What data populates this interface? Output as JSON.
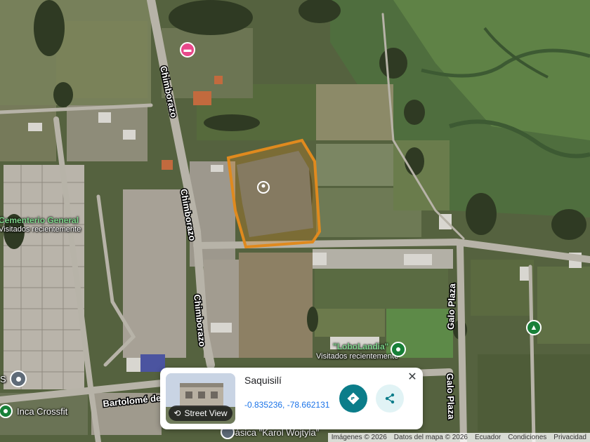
{
  "map": {
    "roads": [
      {
        "label": "Chimborazo",
        "id": "road-chimborazo-north"
      },
      {
        "label": "Chimborazo",
        "id": "road-chimborazo-middle"
      },
      {
        "label": "Chimborazo",
        "id": "road-chimborazo-south"
      },
      {
        "label": "Galo Plaza",
        "id": "road-galo-plaza-north"
      },
      {
        "label": "Galo Plaza",
        "id": "road-galo-plaza-south"
      },
      {
        "label": "Bartolomé de",
        "id": "road-bartolome"
      }
    ],
    "places": {
      "cementerio": {
        "name": "Cementerio General",
        "sub": "Visitados recientemente"
      },
      "lobolandia": {
        "name": "\"LoboLandia\"",
        "sub": "Visitados recientemente"
      },
      "inca": {
        "name": "Inca Crossfit"
      },
      "karol": {
        "name": "Básica \"Karol Wojtyla\""
      },
      "edge_s": {
        "name": "S"
      }
    },
    "icons": {
      "hotel": "bed-icon",
      "selected": "location-pin-icon",
      "park": "tree-icon"
    },
    "colors": {
      "selection_outline": "#e08a1e",
      "place_green": "#188038",
      "hotel_pink": "#e8488a",
      "action_teal": "#0b7d8a"
    }
  },
  "card": {
    "title": "Saquisilí",
    "coords": "-0.835236, -78.662131",
    "street_view_label": "Street View"
  },
  "footer": {
    "imagery": "Imágenes © 2026",
    "map_data": "Datos del mapa © 2026",
    "country": "Ecuador",
    "terms": "Condiciones",
    "privacy": "Privacidad"
  }
}
